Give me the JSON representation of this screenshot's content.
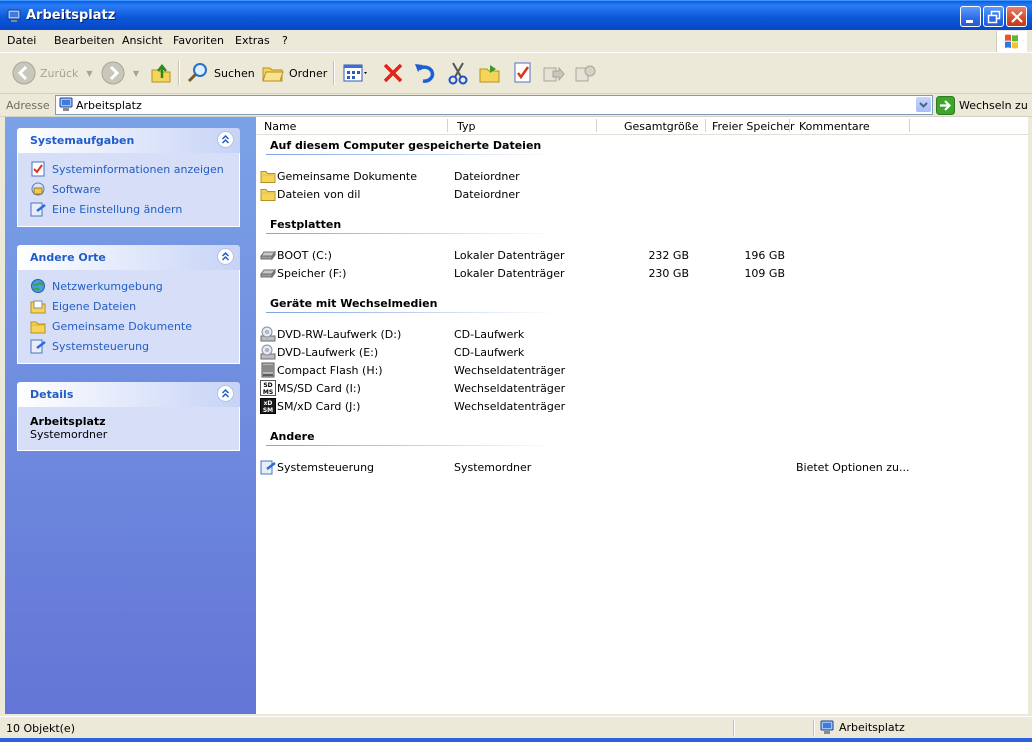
{
  "window": {
    "title": "Arbeitsplatz"
  },
  "menu": [
    "Datei",
    "Bearbeiten",
    "Ansicht",
    "Favoriten",
    "Extras",
    "?"
  ],
  "toolbar": {
    "back": "Zurück",
    "search": "Suchen",
    "folders": "Ordner"
  },
  "address": {
    "label": "Adresse",
    "value": "Arbeitsplatz",
    "go": "Wechseln zu"
  },
  "sidebar": {
    "system_tasks": {
      "title": "Systemaufgaben",
      "items": [
        "Systeminformationen anzeigen",
        "Software",
        "Eine Einstellung ändern"
      ]
    },
    "other_places": {
      "title": "Andere Orte",
      "items": [
        "Netzwerkumgebung",
        "Eigene Dateien",
        "Gemeinsame Dokumente",
        "Systemsteuerung"
      ]
    },
    "details": {
      "title": "Details",
      "name": "Arbeitsplatz",
      "type": "Systemordner"
    }
  },
  "columns": {
    "name": "Name",
    "type": "Typ",
    "total": "Gesamtgröße",
    "free": "Freier Speicher",
    "comment": "Kommentare"
  },
  "groups": [
    {
      "title": "Auf diesem Computer gespeicherte Dateien",
      "items": [
        {
          "icon": "folder-icon",
          "name": "Gemeinsame Dokumente",
          "type": "Dateiordner",
          "total": "",
          "free": "",
          "comment": ""
        },
        {
          "icon": "folder-icon",
          "name": "Dateien von dil",
          "type": "Dateiordner",
          "total": "",
          "free": "",
          "comment": ""
        }
      ]
    },
    {
      "title": "Festplatten",
      "items": [
        {
          "icon": "hard-drive-icon",
          "name": "BOOT (C:)",
          "type": "Lokaler Datenträger",
          "total": "232 GB",
          "free": "196 GB",
          "comment": ""
        },
        {
          "icon": "hard-drive-icon",
          "name": "Speicher (F:)",
          "type": "Lokaler Datenträger",
          "total": "230 GB",
          "free": "109 GB",
          "comment": ""
        }
      ]
    },
    {
      "title": "Geräte mit Wechselmedien",
      "items": [
        {
          "icon": "cd-drive-icon",
          "name": "DVD-RW-Laufwerk (D:)",
          "type": "CD-Laufwerk",
          "total": "",
          "free": "",
          "comment": ""
        },
        {
          "icon": "cd-drive-icon",
          "name": "DVD-Laufwerk (E:)",
          "type": "CD-Laufwerk",
          "total": "",
          "free": "",
          "comment": ""
        },
        {
          "icon": "compact-flash-icon",
          "name": "Compact Flash (H:)",
          "type": "Wechseldatenträger",
          "total": "",
          "free": "",
          "comment": ""
        },
        {
          "icon": "ms-sd-card-icon",
          "name": "MS/SD Card (I:)",
          "type": "Wechseldatenträger",
          "total": "",
          "free": "",
          "comment": ""
        },
        {
          "icon": "sm-xd-card-icon",
          "name": "SM/xD Card (J:)",
          "type": "Wechseldatenträger",
          "total": "",
          "free": "",
          "comment": ""
        }
      ]
    },
    {
      "title": "Andere",
      "items": [
        {
          "icon": "control-panel-icon",
          "name": "Systemsteuerung",
          "type": "Systemordner",
          "total": "",
          "free": "",
          "comment": "Bietet Optionen zu..."
        }
      ]
    }
  ],
  "status": {
    "count": "10 Objekt(e)",
    "location": "Arbeitsplatz"
  }
}
